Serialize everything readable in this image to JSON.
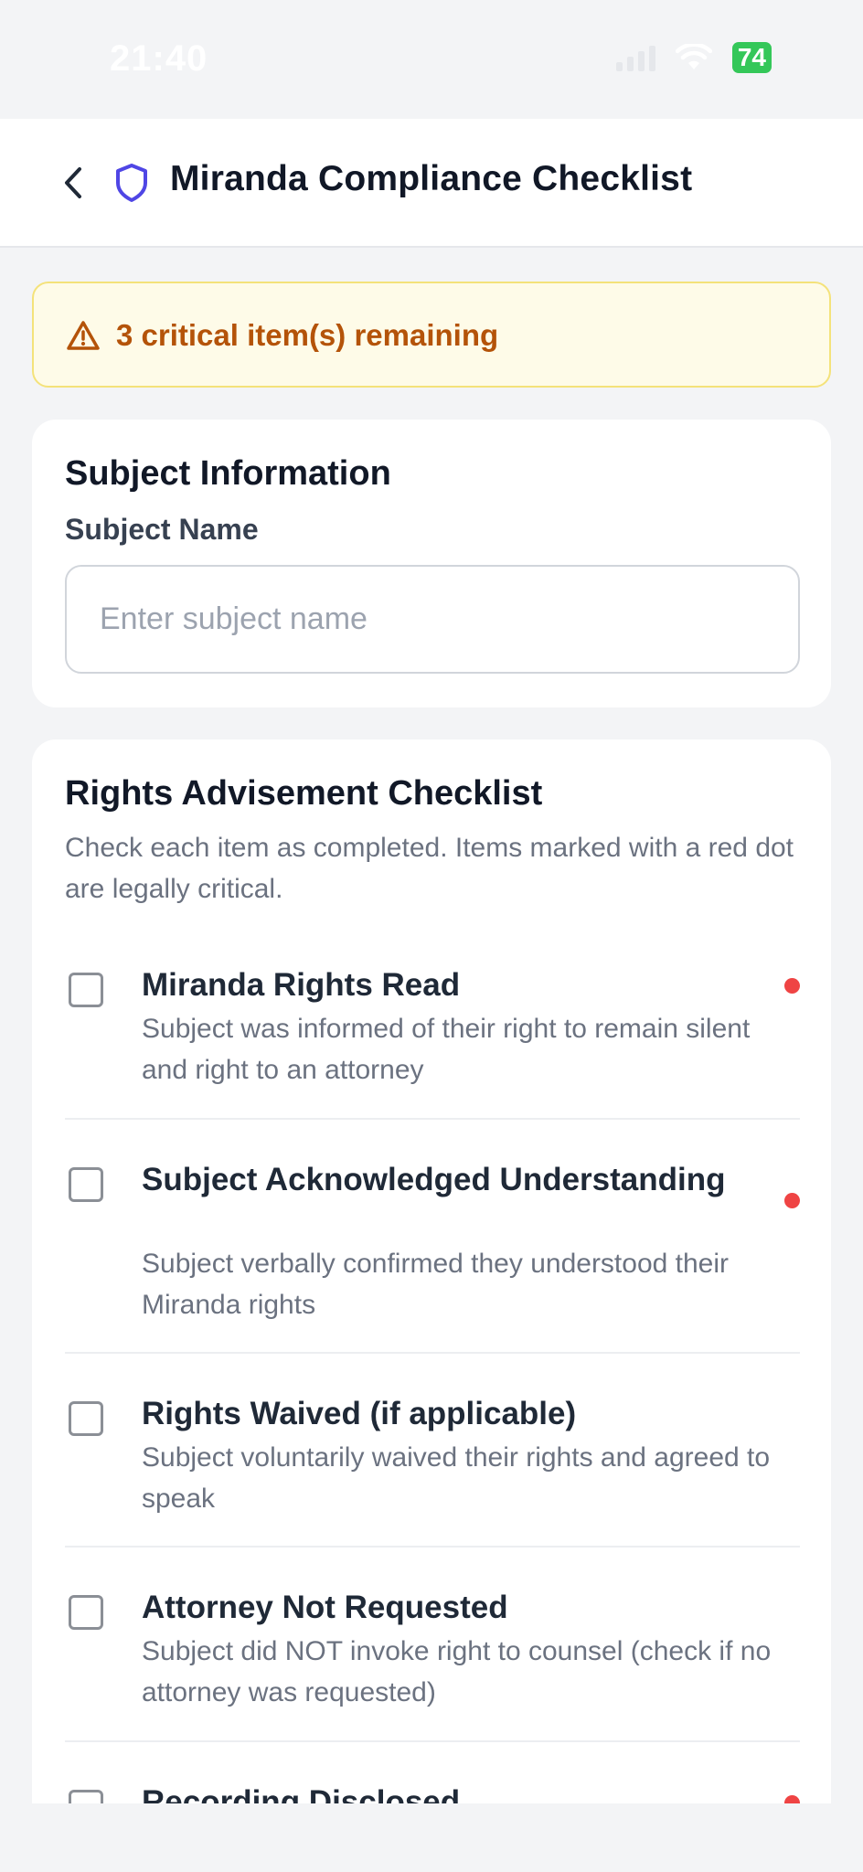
{
  "status_bar": {
    "time": "21:40",
    "battery": "74"
  },
  "header": {
    "title": "Miranda Compliance Checklist"
  },
  "alert": {
    "text": "3 critical item(s) remaining"
  },
  "subject_card": {
    "title": "Subject Information",
    "field_label": "Subject Name",
    "input_value": "",
    "input_placeholder": "Enter subject name"
  },
  "checklist": {
    "title": "Rights Advisement Checklist",
    "description": "Check each item as completed. Items marked with a red dot are legally critical.",
    "items": [
      {
        "title": "Miranda Rights Read",
        "description": "Subject was informed of their right to remain silent and right to an attorney",
        "critical": true,
        "checked": false
      },
      {
        "title": "Subject Acknowledged Understanding",
        "description": "Subject verbally confirmed they understood their Miranda rights",
        "critical": true,
        "checked": false
      },
      {
        "title": "Rights Waived (if applicable)",
        "description": "Subject voluntarily waived their rights and agreed to speak",
        "critical": false,
        "checked": false
      },
      {
        "title": "Attorney Not Requested",
        "description": "Subject did NOT invoke right to counsel (check if no attorney was requested)",
        "critical": false,
        "checked": false
      },
      {
        "title": "Recording Disclosed",
        "description": "",
        "critical": true,
        "checked": false
      }
    ]
  },
  "colors": {
    "accent": "#4f46e5",
    "warning_text": "#b45309",
    "warning_bg": "#fefbe8",
    "critical": "#ef4444"
  }
}
